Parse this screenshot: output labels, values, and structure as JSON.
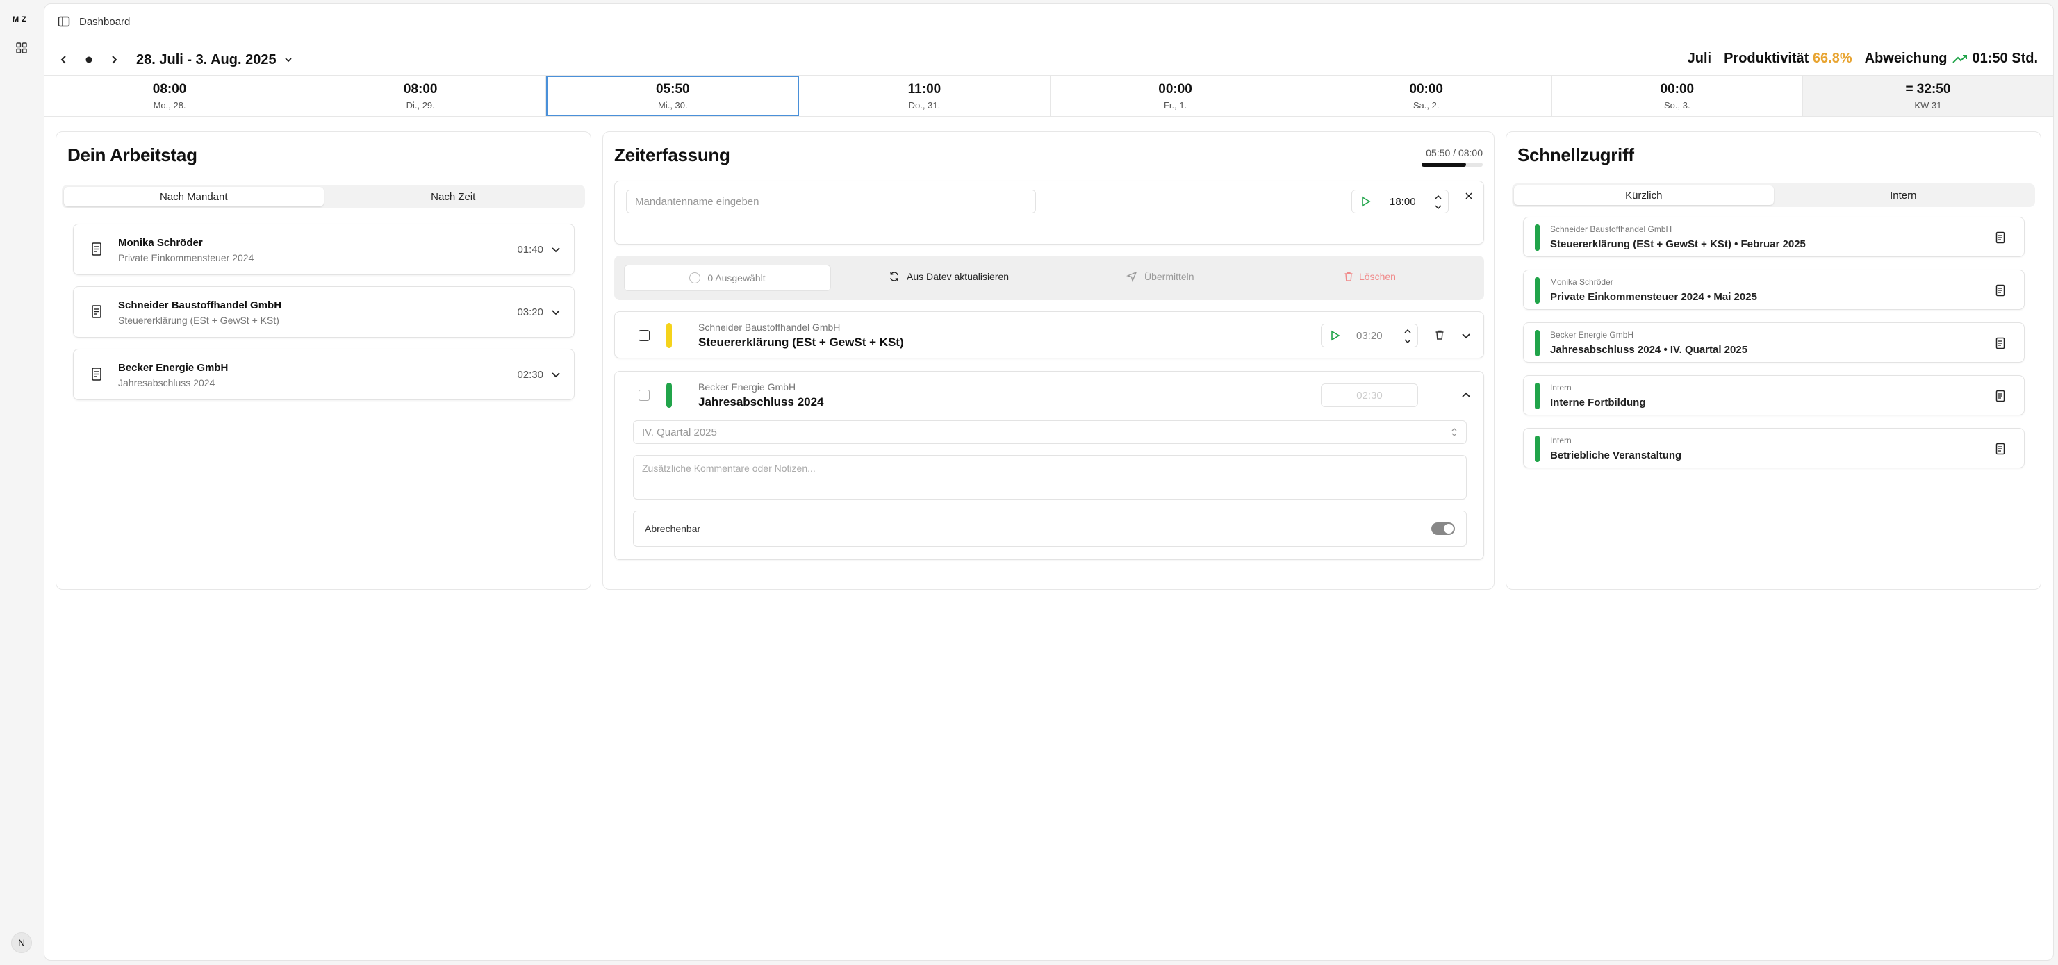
{
  "rail": {
    "logo": "M Z",
    "avatar": "N"
  },
  "topbar": {
    "breadcrumb": "Dashboard"
  },
  "week": {
    "range": "28. Juli - 3. Aug. 2025",
    "month": "Juli",
    "productivity_label": "Produktivität",
    "productivity_value": "66.8%",
    "deviation_label": "Abweichung",
    "deviation_value": "01:50 Std."
  },
  "days": [
    {
      "time": "08:00",
      "label": "Mo., 28."
    },
    {
      "time": "08:00",
      "label": "Di., 29."
    },
    {
      "time": "05:50",
      "label": "Mi., 30."
    },
    {
      "time": "11:00",
      "label": "Do., 31."
    },
    {
      "time": "00:00",
      "label": "Fr., 1."
    },
    {
      "time": "00:00",
      "label": "Sa., 2."
    },
    {
      "time": "00:00",
      "label": "So., 3."
    },
    {
      "time": "= 32:50",
      "label": "KW 31"
    }
  ],
  "arbeitstag": {
    "title": "Dein Arbeitstag",
    "tab_mandant": "Nach Mandant",
    "tab_zeit": "Nach Zeit",
    "clients": [
      {
        "name": "Monika Schröder",
        "sub": "Private Einkommensteuer 2024",
        "time": "01:40"
      },
      {
        "name": "Schneider Baustoffhandel GmbH",
        "sub": "Steuererklärung (ESt + GewSt + KSt)",
        "time": "03:20"
      },
      {
        "name": "Becker Energie GmbH",
        "sub": "Jahresabschluss 2024",
        "time": "02:30"
      }
    ]
  },
  "zeiterfassung": {
    "title": "Zeiterfassung",
    "progress": "05:50 / 08:00",
    "progress_fraction": 0.729,
    "client_placeholder": "Mandantenname eingeben",
    "new_time": "18:00",
    "selected_count": "0 Ausgewählt",
    "datev_refresh": "Aus Datev aktualisieren",
    "submit": "Übermitteln",
    "delete": "Löschen",
    "entries": [
      {
        "client": "Schneider Baustoffhandel GmbH",
        "title": "Steuererklärung (ESt + GewSt + KSt)",
        "time": "03:20",
        "color": "#f5d31b"
      },
      {
        "client": "Becker Energie GmbH",
        "title": "Jahresabschluss 2024",
        "time": "02:30",
        "color": "#21a44a"
      }
    ],
    "quarter_select": "IV. Quartal 2025",
    "comment_placeholder": "Zusätzliche Kommentare oder Notizen...",
    "billable_label": "Abrechenbar"
  },
  "schnellzugriff": {
    "title": "Schnellzugriff",
    "tab_recent": "Kürzlich",
    "tab_intern": "Intern",
    "items": [
      {
        "client": "Schneider Baustoffhandel GmbH",
        "title": "Steuererklärung (ESt + GewSt + KSt) • Februar 2025"
      },
      {
        "client": "Monika Schröder",
        "title": "Private Einkommensteuer 2024 • Mai 2025"
      },
      {
        "client": "Becker Energie GmbH",
        "title": "Jahresabschluss 2024 • IV. Quartal 2025"
      },
      {
        "client": "Intern",
        "title": "Interne Fortbildung"
      },
      {
        "client": "Intern",
        "title": "Betriebliche Veranstaltung"
      }
    ]
  }
}
